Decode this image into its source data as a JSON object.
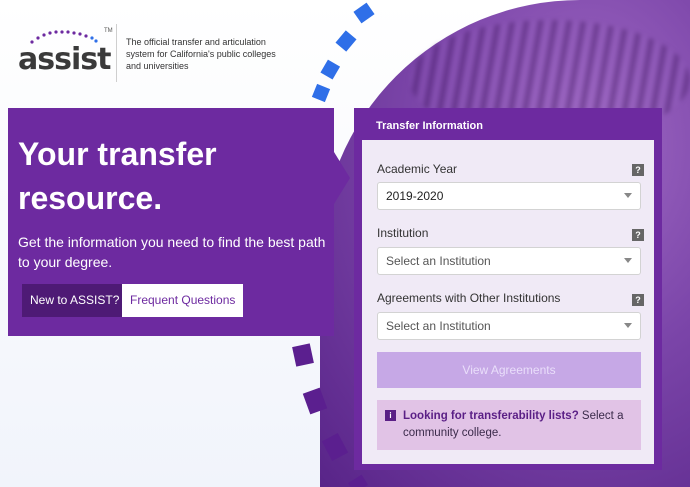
{
  "header": {
    "logo_text": "assist",
    "trademark": "TM",
    "tagline": "The official transfer and articulation system for California's public colleges and universities"
  },
  "hero": {
    "title": "Your transfer resource.",
    "description": "Get the information you need to find the best path to your degree.",
    "new_button": "New to ASSIST?",
    "faq_button": "Frequent Questions"
  },
  "panel": {
    "title": "Transfer Information",
    "academic_year_label": "Academic Year",
    "academic_year_value": "2019-2020",
    "institution_label": "Institution",
    "institution_placeholder": "Select an Institution",
    "agreements_label": "Agreements with Other Institutions",
    "agreements_placeholder": "Select an Institution",
    "help_glyph": "?",
    "view_button": "View Agreements",
    "note_icon": "i",
    "note_bold": "Looking for transferability lists?",
    "note_text": " Select a community college."
  },
  "colors": {
    "brand_purple": "#6d2aa0",
    "dark_purple": "#4e1a75",
    "stripe_blue": "#2f6fe8",
    "stripe_purple": "#5b1f8f"
  },
  "icons": {
    "help": "help-icon",
    "info": "info-icon",
    "chevron": "chevron-down-icon"
  }
}
